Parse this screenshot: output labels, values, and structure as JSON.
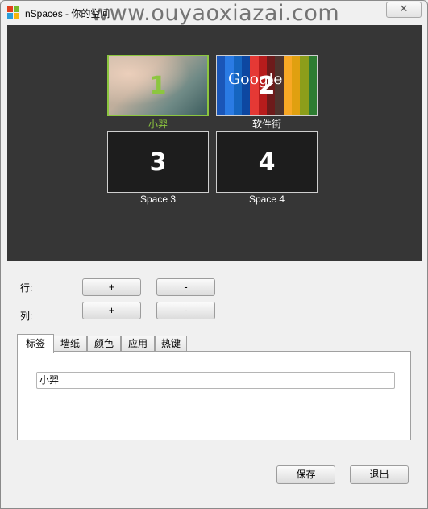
{
  "window": {
    "title": "nSpaces - 你的空间",
    "watermark": "www.ouyaoxiazai.com",
    "close_glyph": "✕"
  },
  "spaces": [
    {
      "number": "1",
      "label": "小羿",
      "active": true,
      "wallpaper": "flowers-photo"
    },
    {
      "number": "2",
      "label": "软件街",
      "active": false,
      "wallpaper": "google-stripes",
      "wallpaper_text": "Google"
    },
    {
      "number": "3",
      "label": "Space 3",
      "active": false,
      "wallpaper": "none"
    },
    {
      "number": "4",
      "label": "Space 4",
      "active": false,
      "wallpaper": "none"
    }
  ],
  "grid_controls": {
    "rows_label": "行:",
    "cols_label": "列:",
    "plus": "+",
    "minus": "-"
  },
  "tabs": [
    "标签",
    "墙纸",
    "颜色",
    "应用",
    "热键"
  ],
  "active_tab": "标签",
  "label_input": {
    "value": "小羿"
  },
  "footer": {
    "save": "保存",
    "exit": "退出"
  },
  "colors": {
    "preview_bg": "#363636",
    "active_accent": "#8cc63f",
    "stripes": [
      "#1a56b8",
      "#2a7be4",
      "#1565c0",
      "#0d47a1",
      "#e53935",
      "#b71c1c",
      "#6d1b1b",
      "#4e342e",
      "#f9a825",
      "#e0a010",
      "#8c9e1a",
      "#2e7d32"
    ]
  }
}
